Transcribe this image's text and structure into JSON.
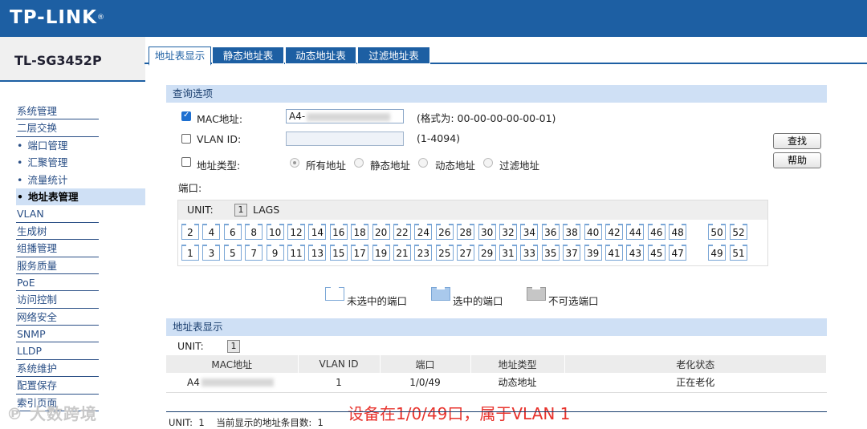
{
  "brand": {
    "logo": "TP-LINK",
    "model": "TL-SG3452P"
  },
  "sidebar": {
    "items": [
      {
        "label": "系统管理",
        "type": "top"
      },
      {
        "label": "二层交换",
        "type": "top"
      },
      {
        "label": "端口管理",
        "type": "sub"
      },
      {
        "label": "汇聚管理",
        "type": "sub"
      },
      {
        "label": "流量统计",
        "type": "sub"
      },
      {
        "label": "地址表管理",
        "type": "sub-active"
      },
      {
        "label": "VLAN",
        "type": "top"
      },
      {
        "label": "生成树",
        "type": "top"
      },
      {
        "label": "组播管理",
        "type": "top"
      },
      {
        "label": "服务质量",
        "type": "top"
      },
      {
        "label": "PoE",
        "type": "top"
      },
      {
        "label": "访问控制",
        "type": "top"
      },
      {
        "label": "网络安全",
        "type": "top"
      },
      {
        "label": "SNMP",
        "type": "top"
      },
      {
        "label": "LLDP",
        "type": "top"
      },
      {
        "label": "系统维护",
        "type": "top"
      },
      {
        "label": "配置保存",
        "type": "top"
      },
      {
        "label": "索引页面",
        "type": "top"
      }
    ]
  },
  "tabs": [
    "地址表显示",
    "静态地址表",
    "动态地址表",
    "过滤地址表"
  ],
  "query": {
    "title": "查询选项",
    "mac_label": "MAC地址:",
    "mac_value": "A4-",
    "mac_hint": "(格式为: 00-00-00-00-00-01)",
    "vlan_label": "VLAN ID:",
    "vlan_hint": "(1-4094)",
    "type_label": "地址类型:",
    "type_options": [
      "所有地址",
      "静态地址",
      "动态地址",
      "过滤地址"
    ],
    "port_label": "端口:",
    "search_button": "查找",
    "help_button": "帮助"
  },
  "unit_panel": {
    "unit_label": "UNIT:",
    "unit_number": "1",
    "lags_label": "LAGS",
    "even_ports": [
      "2",
      "4",
      "6",
      "8",
      "10",
      "12",
      "14",
      "16",
      "18",
      "20",
      "22",
      "24",
      "26",
      "28",
      "30",
      "32",
      "34",
      "36",
      "38",
      "40",
      "42",
      "44",
      "46",
      "48"
    ],
    "odd_ports": [
      "1",
      "3",
      "5",
      "7",
      "9",
      "11",
      "13",
      "15",
      "17",
      "19",
      "21",
      "23",
      "25",
      "27",
      "29",
      "31",
      "33",
      "35",
      "37",
      "39",
      "41",
      "43",
      "45",
      "47"
    ],
    "sfp_even": [
      "50",
      "52"
    ],
    "sfp_odd": [
      "49",
      "51"
    ]
  },
  "legend": {
    "unselected": "未选中的端口",
    "selected": "选中的端口",
    "disabled": "不可选端口"
  },
  "results": {
    "title": "地址表显示",
    "unit_label": "UNIT:",
    "unit_number": "1",
    "columns": [
      "MAC地址",
      "VLAN ID",
      "端口",
      "地址类型",
      "老化状态"
    ],
    "rows": [
      {
        "mac": "A4",
        "vlan": "1",
        "port": "1/0/49",
        "type": "动态地址",
        "aging": "正在老化"
      }
    ]
  },
  "annotation": "设备在1/0/49口，属于VLAN 1",
  "footer": {
    "unit_label": "UNIT:",
    "unit_number": "1",
    "count_label": "当前显示的地址条目数:",
    "count": "1"
  },
  "watermark": "大数跨境",
  "colors": {
    "brand_blue": "#1d5fa3",
    "section_bg": "#cfe0f5",
    "annotation_red": "#e8342e"
  }
}
